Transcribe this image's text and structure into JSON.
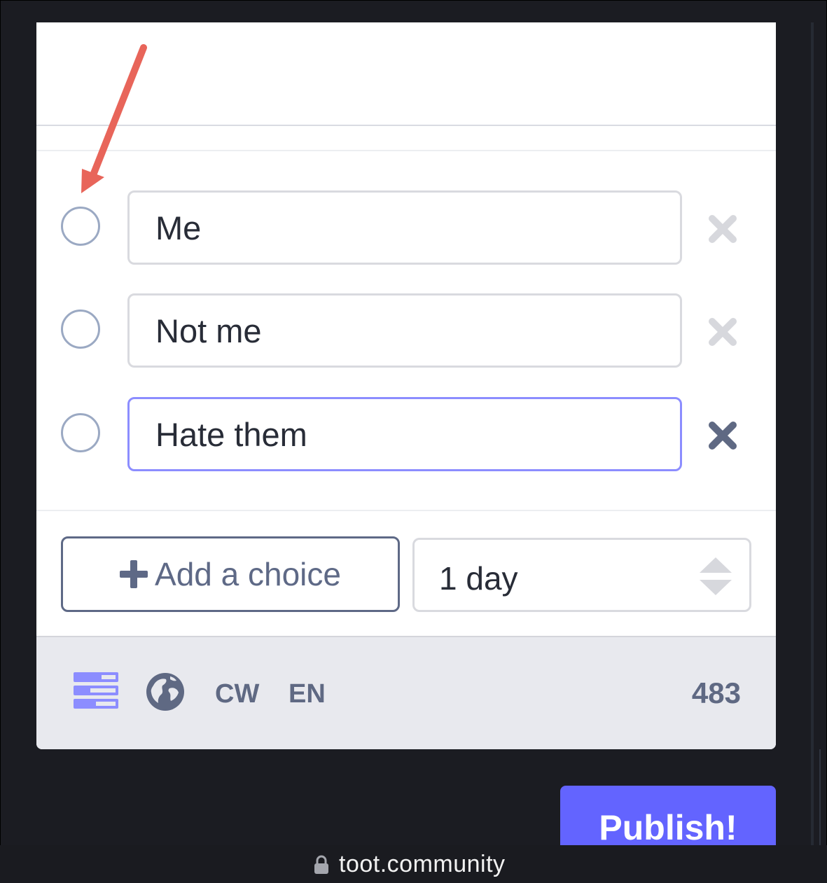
{
  "poll": {
    "options": [
      {
        "value": "Me",
        "focused": false
      },
      {
        "value": "Not me",
        "focused": false
      },
      {
        "value": "Hate them",
        "focused": true
      }
    ],
    "add_choice_label": "Add a choice",
    "duration_label": "1 day"
  },
  "toolbar": {
    "cw_label": "CW",
    "language_label": "EN",
    "char_count": "483",
    "poll_icon": "poll-icon",
    "visibility_icon": "globe-icon"
  },
  "actions": {
    "publish_label": "Publish!"
  },
  "browser": {
    "url": "toot.community",
    "lock_icon": "lock-icon"
  },
  "colors": {
    "accent": "#6364ff",
    "focus_border": "#8c8dff",
    "annotation_arrow": "#e8655a",
    "icon_gray": "#5f6983"
  }
}
